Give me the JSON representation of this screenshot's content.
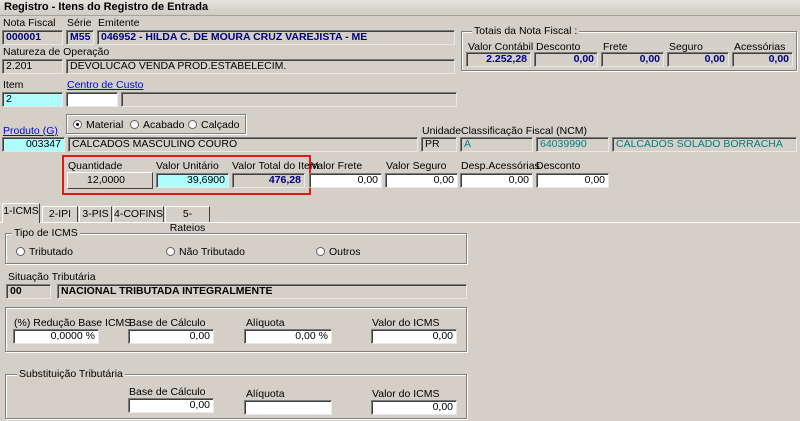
{
  "window": {
    "title": "Registro - Itens do Registro de Entrada"
  },
  "header": {
    "nota_fiscal_label": "Nota Fiscal",
    "nota_fiscal": "000001",
    "serie_label": "Série",
    "serie": "M55",
    "emitente_label": "Emitente",
    "emitente": "046952 - HILDA C. DE MOURA CRUZ VAREJISTA - ME",
    "natureza_label": "Natureza de Operação",
    "natureza_code": "2.201",
    "natureza_desc": "DEVOLUCAO VENDA PROD.ESTABELECIM.",
    "item_label": "Item",
    "item": "2",
    "centro_custo_label": "Centro de Custo"
  },
  "totals": {
    "title": "Totais da Nota Fiscal :",
    "valor_contabil_label": "Valor Contábil",
    "valor_contabil": "2.252,28",
    "desconto_label": "Desconto",
    "desconto": "0,00",
    "frete_label": "Frete",
    "frete": "0,00",
    "seguro_label": "Seguro",
    "seguro": "0,00",
    "acessorias_label": "Acessórias",
    "acessorias": "0,00"
  },
  "tipo_produto": {
    "options": [
      "Material",
      "Acabado",
      "Calçado"
    ],
    "selected": "Material"
  },
  "produto": {
    "label": "Produto (G)",
    "code": "003347",
    "desc": "CALCADOS MASCULINO COURO",
    "unidade_label": "Unidade",
    "unidade": "PR",
    "ncm_label": "Classificação Fiscal (NCM)",
    "ncm_letter": "A",
    "ncm_code": "64039990",
    "ncm_desc": "CALCADOS SOLADO BORRACHA"
  },
  "values": {
    "quantidade_label": "Quantidade",
    "quantidade": "12,0000",
    "valor_unitario_label": "Valor Unitário",
    "valor_unitario": "39,6900",
    "valor_total_label": "Valor Total do Item",
    "valor_total": "476,28",
    "valor_frete_label": "Valor Frete",
    "valor_frete": "0,00",
    "valor_seguro_label": "Valor Seguro",
    "valor_seguro": "0,00",
    "desp_acessorias_label": "Desp.Acessórias",
    "desp_acessorias": "0,00",
    "desconto_label": "Desconto",
    "desconto": "0,00"
  },
  "tabs": [
    "1-ICMS",
    "2-IPI",
    "3-PIS",
    "4-COFINS",
    "5-Rateios"
  ],
  "icms": {
    "tipo_title": "Tipo de ICMS",
    "tipo_options": [
      "Tributado",
      "Não Tributado",
      "Outros"
    ],
    "situacao_label": "Situação Tributária",
    "situacao_code": "00",
    "situacao_desc": "NACIONAL TRIBUTADA INTEGRALMENTE",
    "reducao_label": "(%) Redução Base ICMS",
    "reducao": "0,0000 %",
    "base_label": "Base de Cálculo",
    "base": "0,00",
    "aliquota_label": "Alíquota",
    "aliquota": "0,00 %",
    "valor_label": "Valor do ICMS",
    "valor": "0,00",
    "st_title": "Substituição Tributária",
    "st_base_label": "Base de Cálculo",
    "st_base": "0,00",
    "st_aliquota_label": "Alíquota",
    "st_aliquota": "",
    "st_valor_label": "Valor do ICMS",
    "st_valor": "0,00"
  }
}
